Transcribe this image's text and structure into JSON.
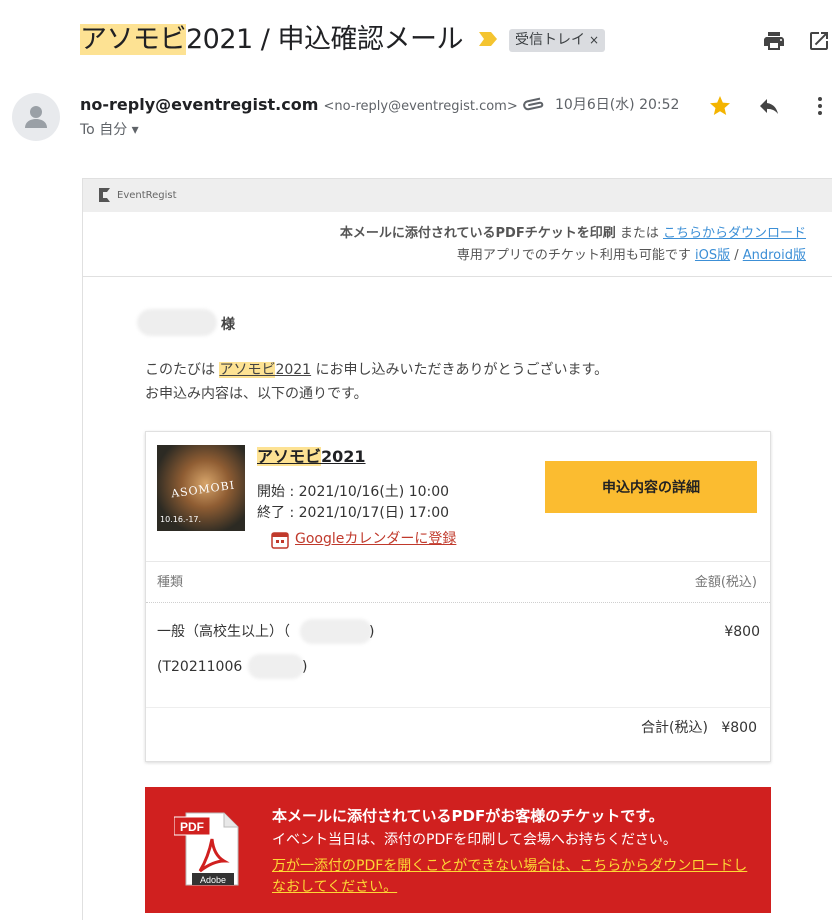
{
  "subject": {
    "highlight": "アソモビ",
    "rest": "2021 / 申込確認メール",
    "label": "受信トレイ",
    "label_close": "×"
  },
  "toolbar": {
    "print_icon": "print-icon",
    "popout_icon": "open-in-new-window-icon"
  },
  "header": {
    "sender_name": "no-reply@eventregist.com",
    "sender_address": "<no-reply@eventregist.com>",
    "to_label": "To",
    "to_value": "自分",
    "date": "10月6日(水) 20:52",
    "starred": true,
    "star_color": "#f4b400"
  },
  "brand": {
    "name": "EventRegist"
  },
  "notice": {
    "line1_bold": "本メールに添付されているPDFチケットを印刷",
    "line1_or": " または ",
    "line1_link": "こちらからダウンロード",
    "line2_text": "専用アプリでのチケット利用も可能です ",
    "ios_link": "iOS版",
    "separator": " / ",
    "android_link": "Android版"
  },
  "greeting": {
    "honorific": "様",
    "intro_before": "このたびは ",
    "event_highlight": "アソモビ",
    "event_rest": "2021",
    "intro_after": " にお申し込みいただきありがとうございます。",
    "intro_line2": "お申込み内容は、以下の通りです。"
  },
  "event": {
    "title_highlight": "アソモビ",
    "title_rest": "2021",
    "start_label": "開始 : ",
    "start_value": "2021/10/16(土) 10:00",
    "end_label": "終了 : ",
    "end_value": "2021/10/17(日) 17:00",
    "calendar_link": "Googleカレンダーに登録",
    "detail_button": "申込内容の詳細",
    "poster_title": "ASOMOBI",
    "poster_dates": "10.16.-17."
  },
  "table": {
    "col_type": "種類",
    "col_price": "金額(税込)",
    "item_name": "一般（高校生以上）（",
    "item_close": ")",
    "item_price": "¥800",
    "ticket_prefix": "(T20211006",
    "ticket_close": ")",
    "total_label": "合計(税込)",
    "total_value": "¥800"
  },
  "pdf_banner": {
    "title": "本メールに添付されているPDFがお客様のチケットです。",
    "subtitle": "イベント当日は、添付のPDFを印刷して会場へお持ちください。",
    "link": "万が一添付のPDFを開くことができない場合は、こちらからダウンロードしなおしてください。",
    "icon_label": "PDF",
    "icon_brand": "Adobe",
    "bg_color": "#d0201f",
    "link_color": "#fdd835"
  }
}
